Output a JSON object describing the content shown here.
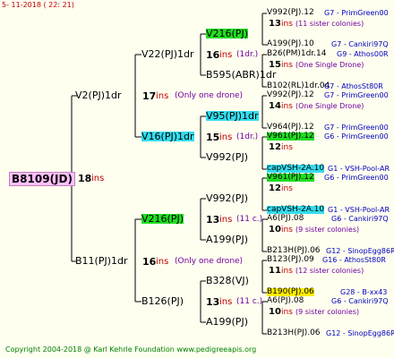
{
  "date": "5- 11-2018 ( 22: 21)",
  "footer": "Copyright 2004-2018 @ Karl Kehrle Foundation    www.pedigreeapis.org",
  "ins_label": "ins",
  "root": {
    "name": "B8109(JD)",
    "count": "18"
  },
  "gen1": [
    {
      "name": "V2(PJ)1dr",
      "count": "17",
      "note": "(Only one drone)"
    },
    {
      "name": "B11(PJ)1dr",
      "count": "16",
      "note": "(Only one drone)"
    }
  ],
  "gen2": [
    {
      "name": "V22(PJ)1dr",
      "count": "16",
      "note": "(1dr.)"
    },
    {
      "name": "V16(PJ)1dr",
      "count": "15",
      "note": "(1dr.)"
    },
    {
      "name": "V216(PJ)",
      "count": "13",
      "note": "(11 c.)"
    },
    {
      "name": "B126(PJ)",
      "count": "13",
      "note": "(11 c.)"
    }
  ],
  "gen3": [
    {
      "name": "V216(PJ)"
    },
    {
      "name": "B595(ABR)1dr"
    },
    {
      "name": "V95(PJ)1dr"
    },
    {
      "name": "V992(PJ)"
    },
    {
      "name": "V992(PJ)"
    },
    {
      "name": "A199(PJ)"
    },
    {
      "name": "B328(VJ)"
    },
    {
      "name": "A199(PJ)"
    }
  ],
  "gen4": [
    {
      "name": "V992(PJ).12",
      "info": "G7 - PrimGreen00",
      "count": "13",
      "note": "(11 sister colonies)"
    },
    {
      "name": "A199(PJ).10",
      "info": "G7 - Cankiri97Q"
    },
    {
      "name": "B26(PM)1dr.14",
      "info": "G9 - Athos00R",
      "count": "15",
      "note": "(One Single Drone)"
    },
    {
      "name": "B102(RL)1dr.04",
      "info": "G7 - AthosSt80R"
    },
    {
      "name": "V992(PJ).12",
      "info": "G7 - PrimGreen00",
      "count": "14",
      "note": "(One Single Drone)"
    },
    {
      "name": "V964(PJ).12",
      "info": "G7 - PrimGreen00"
    },
    {
      "name": "V961(PJ).12",
      "info": "G6 - PrimGreen00",
      "count": "12"
    },
    {
      "name": "capVSH-2A.10",
      "info": "G1 - VSH-Pool-AR"
    },
    {
      "name": "V961(PJ).12",
      "info": "G6 - PrimGreen00",
      "count": "12"
    },
    {
      "name": "capVSH-2A.10",
      "info": "G1 - VSH-Pool-AR"
    },
    {
      "name": "A6(PJ).08",
      "info": "G6 - Cankiri97Q",
      "count": "10",
      "note": "(9 sister colonies)"
    },
    {
      "name": "B213H(PJ).06",
      "info": "G12 - SinopEgg86R"
    },
    {
      "name": "B123(PJ).09",
      "info": "G16 - AthosSt80R",
      "count": "11",
      "note": "(12 sister colonies)"
    },
    {
      "name": "B190(PJ).06",
      "info": "G28 - B-xx43"
    },
    {
      "name": "A6(PJ).08",
      "info": "G6 - Cankiri97Q",
      "count": "10",
      "note": "(9 sister colonies)"
    },
    {
      "name": "B213H(PJ).06",
      "info": "G12 - SinopEgg86R"
    }
  ],
  "colors": {
    "line": "#000000",
    "bg": "#fffff0",
    "hl_green": "#22dd22",
    "hl_cyan": "#33ddee",
    "hl_yellow": "#ffee00"
  }
}
